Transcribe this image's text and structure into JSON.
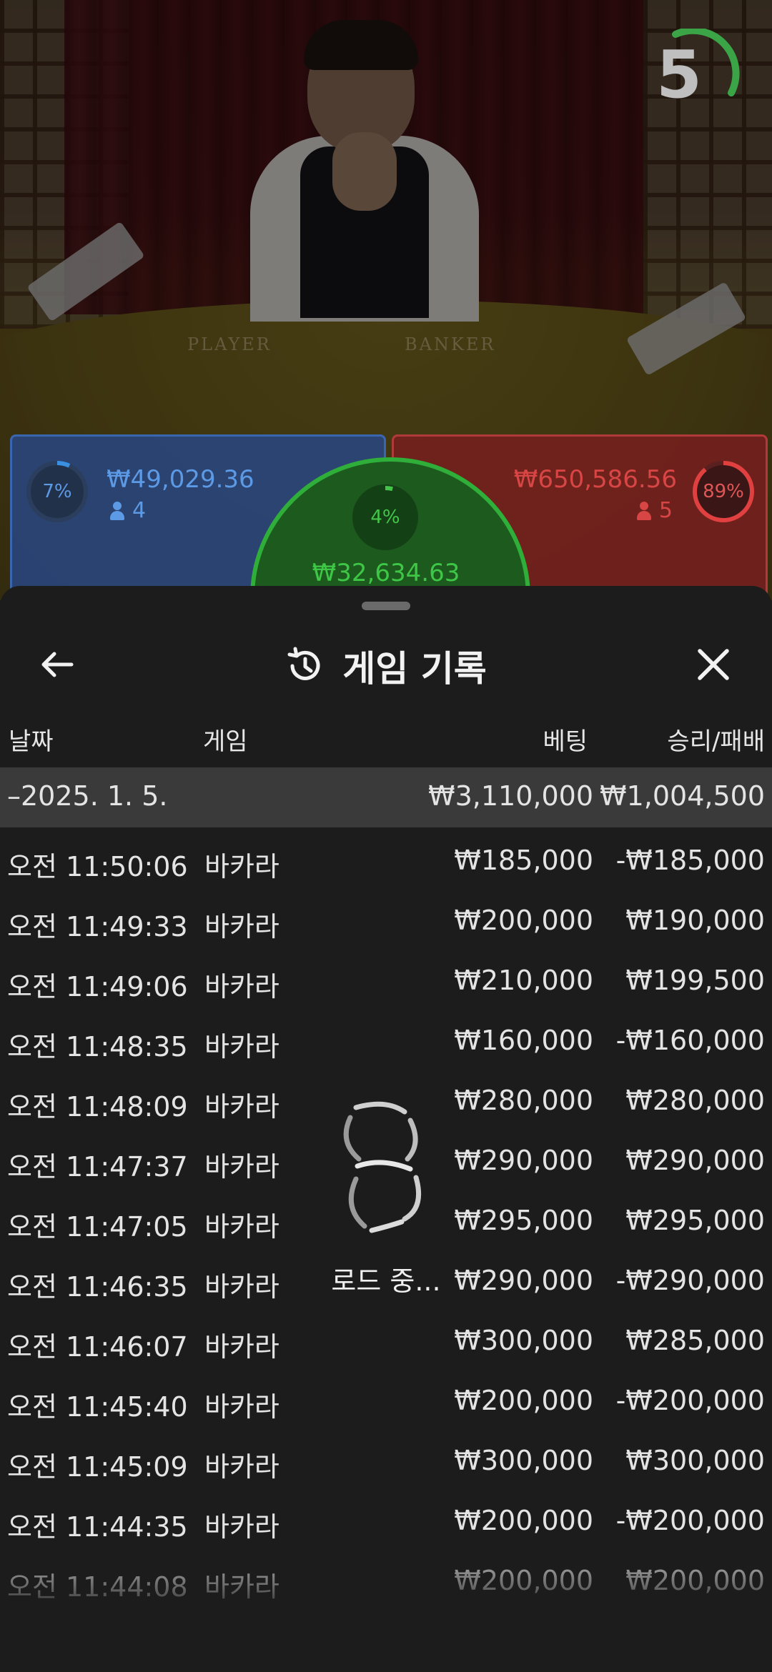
{
  "video": {
    "timer_value": "5",
    "table_player_label": "PLAYER",
    "table_banker_label": "BANKER",
    "player": {
      "percent": "7%",
      "amount": "₩49,029.36",
      "count": "4",
      "percent_value": 0.07,
      "color": "#3a66b0"
    },
    "tie": {
      "percent": "4%",
      "amount": "₩32,634.63",
      "percent_value": 0.04,
      "color": "#2fae3a"
    },
    "banker": {
      "percent": "89%",
      "amount": "₩650,586.56",
      "count": "5",
      "percent_value": 0.89,
      "color": "#d03a3a"
    }
  },
  "sheet": {
    "title": "게임 기록",
    "back_icon": "arrow-left-icon",
    "history_icon": "history-icon",
    "close_icon": "close-icon",
    "columns": {
      "date": "날짜",
      "game": "게임",
      "bet": "베팅",
      "result": "승리/패배"
    },
    "day_group": {
      "date": "–2025. 1. 5.",
      "bet_total": "₩3,110,000",
      "result_total": "₩1,004,500"
    },
    "rows": [
      {
        "time": "오전 11:50:06",
        "game": "바카라",
        "bet": "₩185,000",
        "result": "-₩185,000"
      },
      {
        "time": "오전 11:49:33",
        "game": "바카라",
        "bet": "₩200,000",
        "result": "₩190,000"
      },
      {
        "time": "오전 11:49:06",
        "game": "바카라",
        "bet": "₩210,000",
        "result": "₩199,500"
      },
      {
        "time": "오전 11:48:35",
        "game": "바카라",
        "bet": "₩160,000",
        "result": "-₩160,000"
      },
      {
        "time": "오전 11:48:09",
        "game": "바카라",
        "bet": "₩280,000",
        "result": "₩280,000"
      },
      {
        "time": "오전 11:47:37",
        "game": "바카라",
        "bet": "₩290,000",
        "result": "₩290,000"
      },
      {
        "time": "오전 11:47:05",
        "game": "바카라",
        "bet": "₩295,000",
        "result": "₩295,000"
      },
      {
        "time": "오전 11:46:35",
        "game": "바카라",
        "bet": "₩290,000",
        "result": "-₩290,000"
      },
      {
        "time": "오전 11:46:07",
        "game": "바카라",
        "bet": "₩300,000",
        "result": "₩285,000"
      },
      {
        "time": "오전 11:45:40",
        "game": "바카라",
        "bet": "₩200,000",
        "result": "-₩200,000"
      },
      {
        "time": "오전 11:45:09",
        "game": "바카라",
        "bet": "₩300,000",
        "result": "₩300,000"
      },
      {
        "time": "오전 11:44:35",
        "game": "바카라",
        "bet": "₩200,000",
        "result": "-₩200,000"
      },
      {
        "time": "오전 11:44:08",
        "game": "바카라",
        "bet": "₩200,000",
        "result": "₩200,000"
      }
    ],
    "loading": {
      "text": "로드 중...",
      "icon": "spinner-icon"
    }
  }
}
